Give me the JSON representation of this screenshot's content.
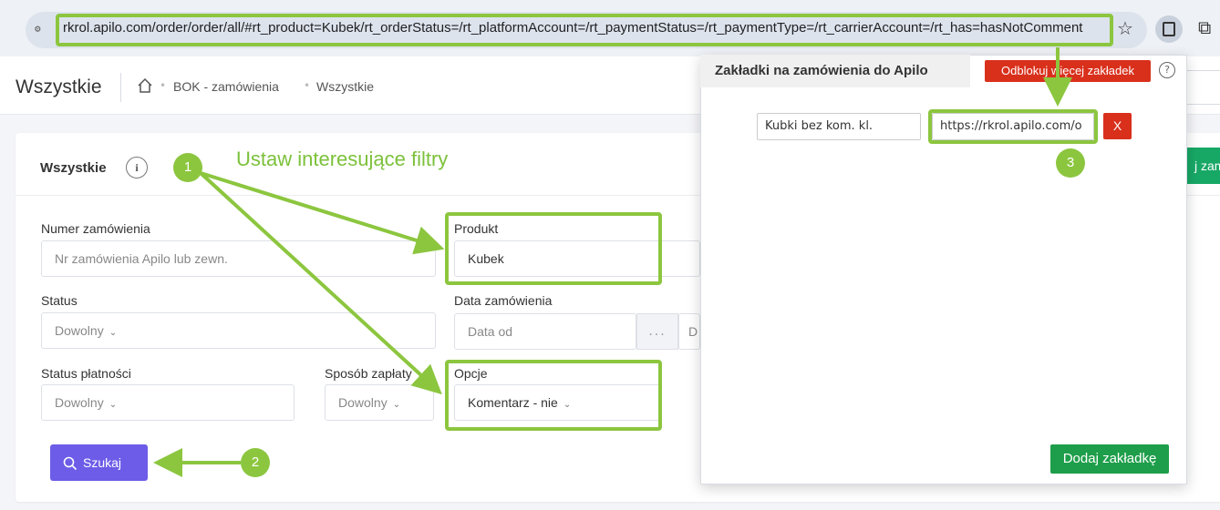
{
  "browser": {
    "site_icon": "site-settings-icon",
    "url": "rkrol.apilo.com/order/order/all/#rt_product=Kubek/rt_orderStatus=/rt_platformAccount=/rt_paymentStatus=/rt_paymentType=/rt_carrierAccount=/rt_has=hasNotComment"
  },
  "header": {
    "title": "Wszystkie",
    "breadcrumb": [
      "BOK - zamówienia",
      "Wszystkie"
    ]
  },
  "card": {
    "title": "Wszystkie",
    "right_button": "j zam"
  },
  "filters": {
    "order_number": {
      "label": "Numer zamówienia",
      "placeholder": "Nr zamówienia Apilo lub zewn."
    },
    "product": {
      "label": "Produkt",
      "value": "Kubek"
    },
    "status": {
      "label": "Status",
      "value": "Dowolny"
    },
    "order_date": {
      "label": "Data zamówienia",
      "from_placeholder": "Data od",
      "dots": "...",
      "to_placeholder_partial": "D"
    },
    "payment_status": {
      "label": "Status płatności",
      "value": "Dowolny"
    },
    "payment_method": {
      "label": "Sposób zapłaty",
      "value": "Dowolny"
    },
    "options": {
      "label": "Opcje",
      "value": "Komentarz - nie"
    }
  },
  "search_button": "Szukaj",
  "annotations": {
    "text": "Ustaw interesujące filtry",
    "badges": [
      "1",
      "2",
      "3"
    ],
    "color": "#8cc63f"
  },
  "popup": {
    "title": "Zakładki na zamówienia do Apilo",
    "unlock": "Odblokuj więcej zakładek",
    "help": "?",
    "bookmark_name": "Kubki bez kom. kl.",
    "bookmark_url": "https://rkrol.apilo.com/o",
    "delete": "X",
    "add": "Dodaj zakładkę"
  }
}
